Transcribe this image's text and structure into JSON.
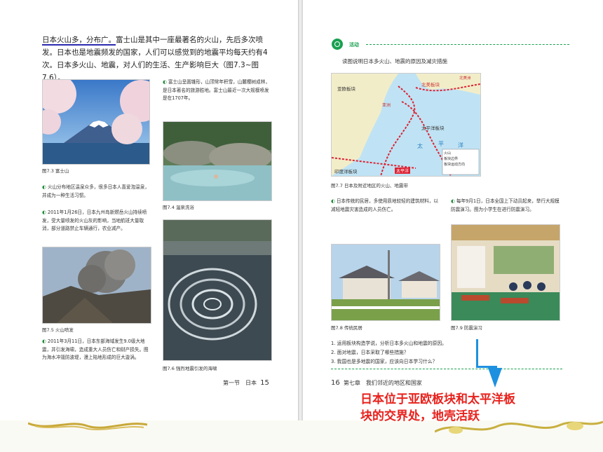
{
  "left_page": {
    "intro_highlight": "日本火山多，分布广。",
    "intro_rest": "富士山是其中一座最著名的火山，先后多次喷发。日本也是地震频发的国家，人们可以感觉到的地震平均每天约有4次。日本多火山、地震，对人们的生活、生产影响巨大（图7.3~图7.6）。",
    "fig73_caption": "图7.3 富士山",
    "fuji_note": "富士山呈圆锥形，山顶常年积雪，山麓樱树成林，是日本著名的旅游胜地。富士山最近一次大规模喷发是在1707年。",
    "fig74_caption": "图7.4 温泉洗浴",
    "hotspring_note": "火山分布地区温泉众多，很多日本人喜爱泡温泉，并成为一种生活习惯。",
    "eruption_note": "2011年1月26日，日本九州岛新燃岳火山持续喷发，受大量喷发的火山灰的影响，当地航班大量取消，部分道路禁止车辆通行，农业减产。",
    "fig75_caption": "图7.5 火山喷发",
    "fig76_caption": "图7.6 强烈地震引发的海啸",
    "tsunami_note": "2011年3月11日，日本东部海域发生9.0级大地震，并引发海啸，造成重大人员伤亡和财产损失。图为海水冲毁防波堤，漫上陆地形成的巨大漩涡。",
    "footer": "第一节　日本",
    "page_no": "15"
  },
  "right_page": {
    "activity_label": "活动",
    "activity_prompt": "读图说明日本多火山、地震的原因及减灾措施",
    "map_labels": {
      "eurasian": "亚欧板块",
      "north_america": "北美板块",
      "pacific": "太平洋板块",
      "indian": "印度洋板块",
      "asia": "亚洲",
      "taiping": "太",
      "ping": "平",
      "yang": "洋",
      "indian_ocean": "太平洋",
      "corner_label": "北美洲",
      "legend_1": "火山",
      "legend_2": "板块边界",
      "legend_3": "板块运动方向"
    },
    "fig77_caption": "图7.7 日本及附近地区的火山、地震带",
    "house_note": "日本传统的民居，多使用质地较轻的建筑材料，以减轻地震灾害造成的人员伤亡。",
    "drill_note": "每年9月1日，日本全国上下动员起来，举行大规模防震演习。图为小学生在进行防震演习。",
    "fig78_caption": "图7.8 传统民居",
    "fig79_caption": "图7.9 防震演习",
    "questions": [
      "1. 运用板块构造学说，分析日本多火山和地震的原因。",
      "2. 面对地震，日本采取了哪些措施？",
      "3. 我国也是多地震的国家，应该向日本学习什么？"
    ],
    "page_no": "16",
    "footer": "第七章　我们邻近的地区和国家"
  },
  "annotation": {
    "line1": "日本位于亚欧板块和太平洋板",
    "line2": "块的交界处，地壳活跃"
  },
  "colors": {
    "annotation_red": "#e8211c",
    "arrow_blue": "#1e90e0",
    "activity_green": "#1aa050"
  }
}
